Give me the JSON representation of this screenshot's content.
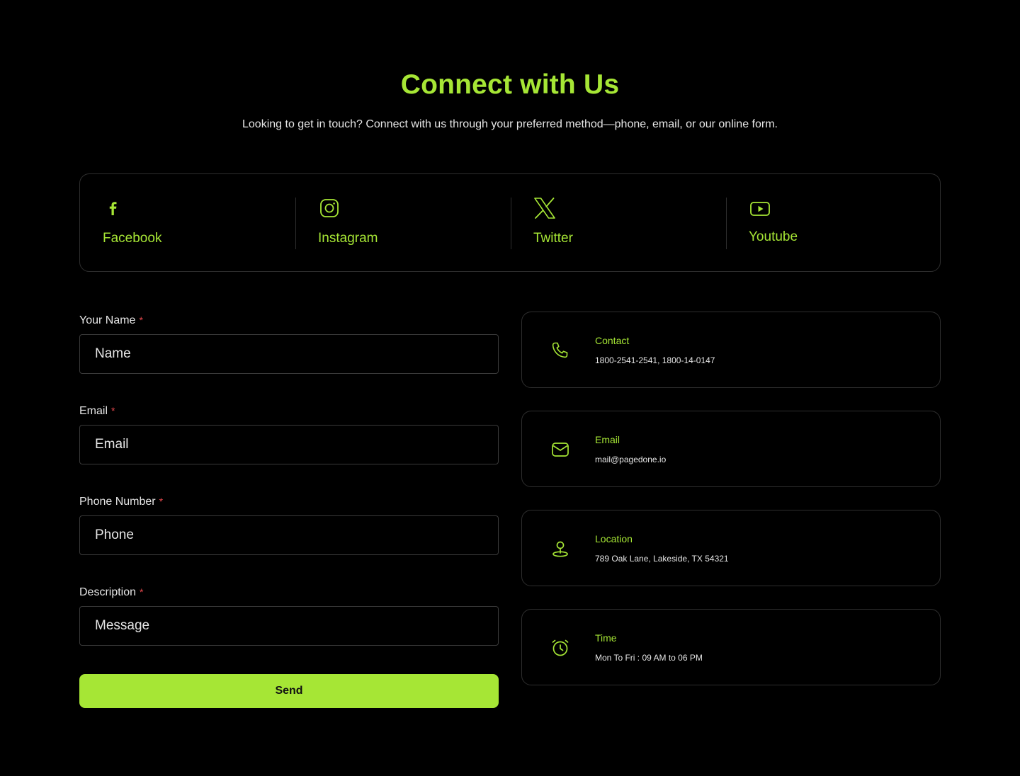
{
  "header": {
    "title": "Connect with Us",
    "subtitle": "Looking to get in touch? Connect with us through your preferred method—phone, email, or our online form."
  },
  "social": [
    {
      "label": "Facebook",
      "icon": "facebook-icon"
    },
    {
      "label": "Instagram",
      "icon": "instagram-icon"
    },
    {
      "label": "Twitter",
      "icon": "x-twitter-icon"
    },
    {
      "label": "Youtube",
      "icon": "youtube-icon"
    }
  ],
  "form": {
    "name": {
      "label": "Your Name",
      "required": "*",
      "placeholder": "Name"
    },
    "email": {
      "label": "Email",
      "required": "*",
      "placeholder": "Email"
    },
    "phone": {
      "label": "Phone Number",
      "required": "*",
      "placeholder": "Phone"
    },
    "description": {
      "label": "Description",
      "required": "*",
      "placeholder": "Message"
    },
    "submit_label": "Send"
  },
  "info": [
    {
      "title": "Contact",
      "value": "1800-2541-2541, 1800-14-0147",
      "icon": "phone-icon"
    },
    {
      "title": "Email",
      "value": "mail@pagedone.io",
      "icon": "mail-icon"
    },
    {
      "title": "Location",
      "value": "789 Oak Lane, Lakeside, TX 54321",
      "icon": "location-pin-icon"
    },
    {
      "title": "Time",
      "value": "Mon To Fri : 09 AM to 06 PM",
      "icon": "alarm-clock-icon"
    }
  ],
  "colors": {
    "accent": "#a6e635",
    "background": "#000000",
    "border": "#2e2e2e",
    "required": "#e5484d"
  }
}
